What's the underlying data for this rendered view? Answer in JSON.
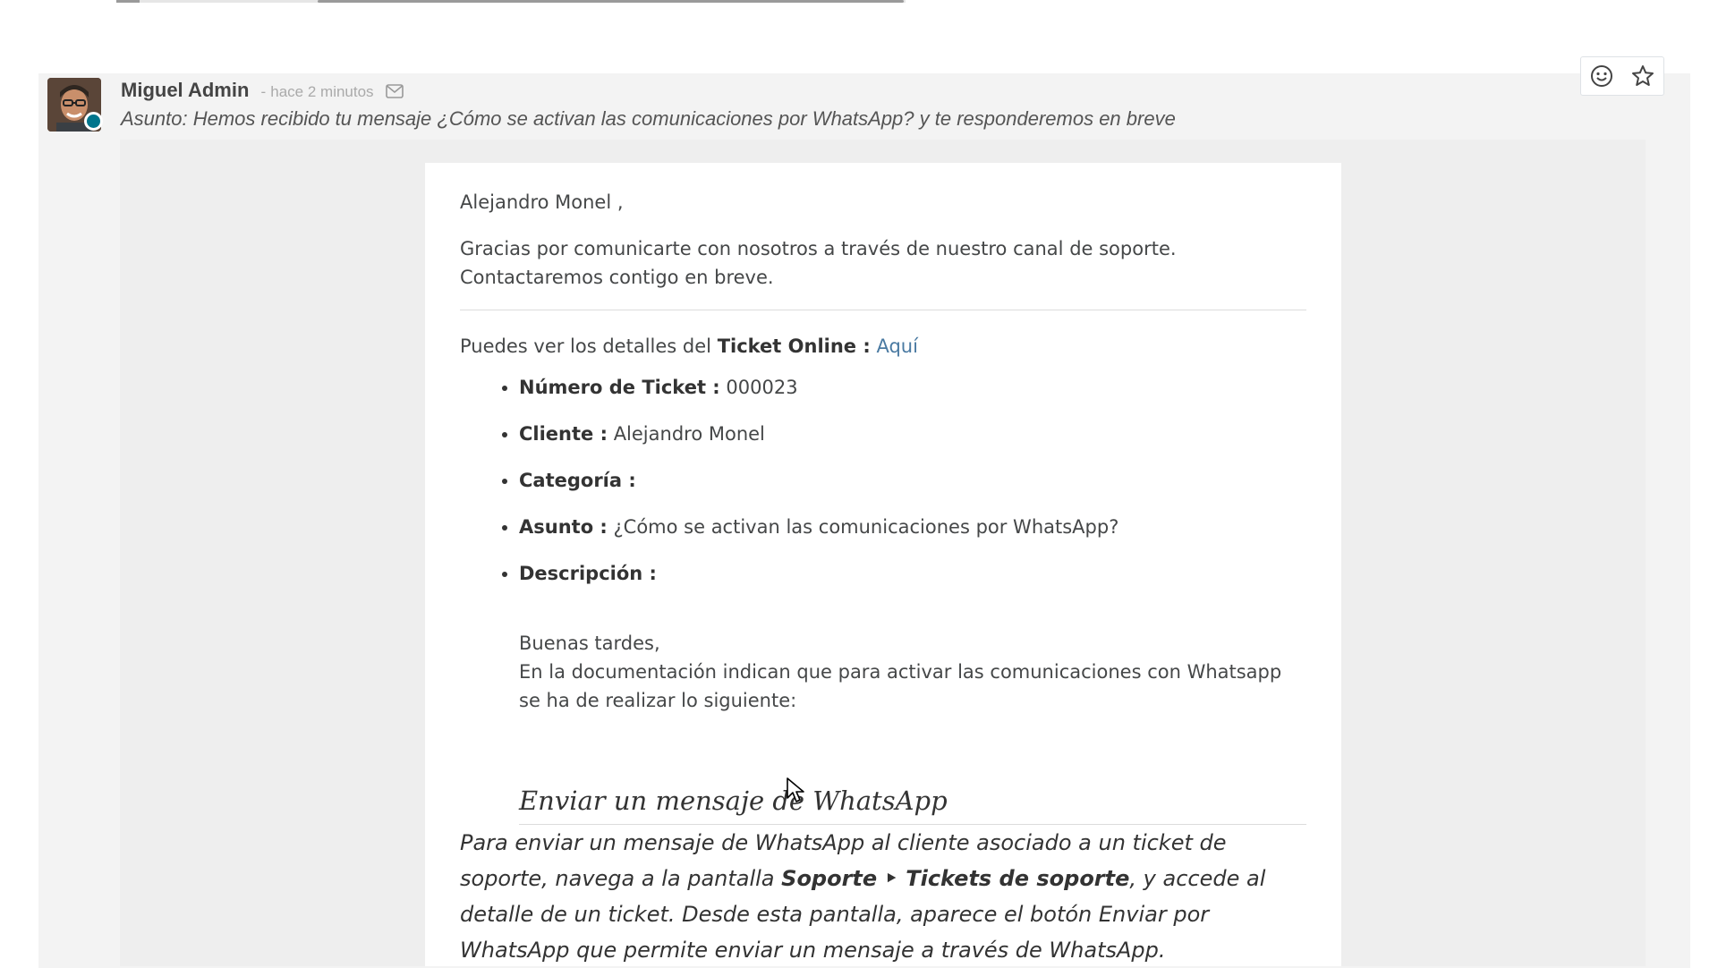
{
  "message": {
    "author": "Miguel Admin",
    "separator": "-",
    "time": "hace 2 minutos",
    "subject": "Asunto: Hemos recibido tu mensaje ¿Cómo se activan las comunicaciones por WhatsApp? y te responderemos en breve"
  },
  "actions": {
    "emoji_icon": "smiley-icon",
    "star_icon": "star-icon"
  },
  "email": {
    "greeting": "Alejandro Monel ,",
    "thanks_line1": "Gracias por comunicarte con nosotros a través de nuestro canal de soporte.",
    "thanks_line2": "Contactaremos contigo en breve.",
    "view_prefix": "Puedes ver los detalles del",
    "view_bold": "Ticket Online :",
    "view_link": "Aquí",
    "details": [
      {
        "label": "Número de Ticket :",
        "value": "000023"
      },
      {
        "label": "Cliente :",
        "value": "Alejandro Monel"
      },
      {
        "label": "Categoría :",
        "value": ""
      },
      {
        "label": "Asunto :",
        "value": "¿Cómo se activan las comunicaciones por WhatsApp?"
      },
      {
        "label": "Descripción :",
        "value": ""
      }
    ],
    "description": {
      "line1": "Buenas tardes,",
      "line2": "En la documentación indican que para activar las comunicaciones con Whatsapp se ha de realizar lo siguiente:"
    },
    "doc": {
      "title": "Enviar un mensaje de WhatsApp",
      "body_pre": "Para enviar un mensaje de WhatsApp al cliente asociado a un ticket de soporte, navega a la pantalla",
      "body_bold": "Soporte ‣ Tickets de soporte",
      "body_post": ", y accede al detalle de un ticket. Desde esta pantalla, aparece el botón Enviar por WhatsApp que permite enviar un mensaje a través de WhatsApp."
    }
  },
  "colors": {
    "status_dot": "#00758c",
    "link": "#4a7aa2"
  }
}
